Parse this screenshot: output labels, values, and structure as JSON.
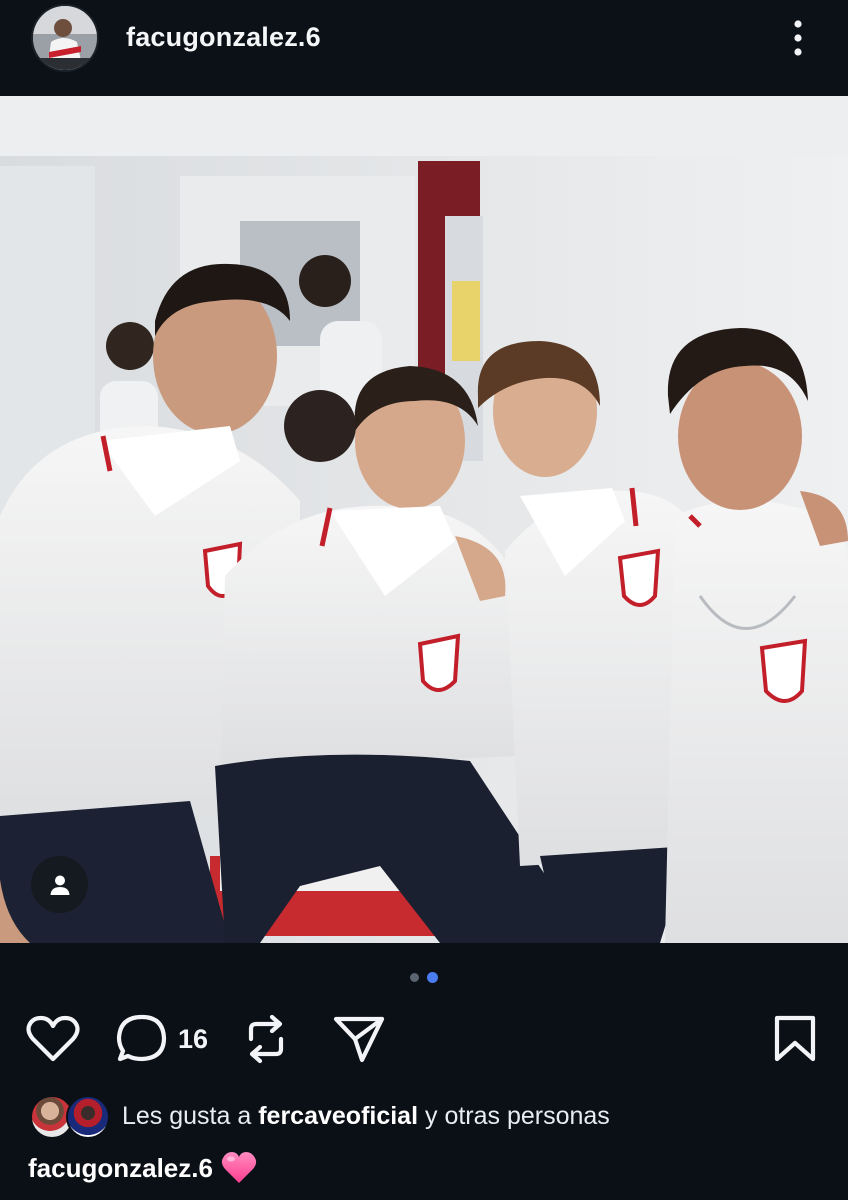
{
  "post": {
    "username": "facugonzalez.6",
    "more_icon": "more-vertical-icon",
    "photo_icon": "user-tag-icon"
  },
  "carousel": {
    "count": 2,
    "active_index": 1
  },
  "actions": {
    "like_icon": "heart-outline-icon",
    "comment_icon": "comment-bubble-icon",
    "comment_count": "16",
    "repost_icon": "repost-icon",
    "share_icon": "send-icon",
    "save_icon": "bookmark-icon"
  },
  "likes": {
    "prefix": "Les gusta a ",
    "user": "fercaveoficial",
    "suffix": " y otras personas"
  },
  "caption": {
    "username": "facugonzalez.6",
    "emoji": "pink-heart"
  },
  "colors": {
    "background": "#0b1016",
    "active_dot": "#4a7cf0",
    "heart_emoji": "#ff5fa2"
  }
}
